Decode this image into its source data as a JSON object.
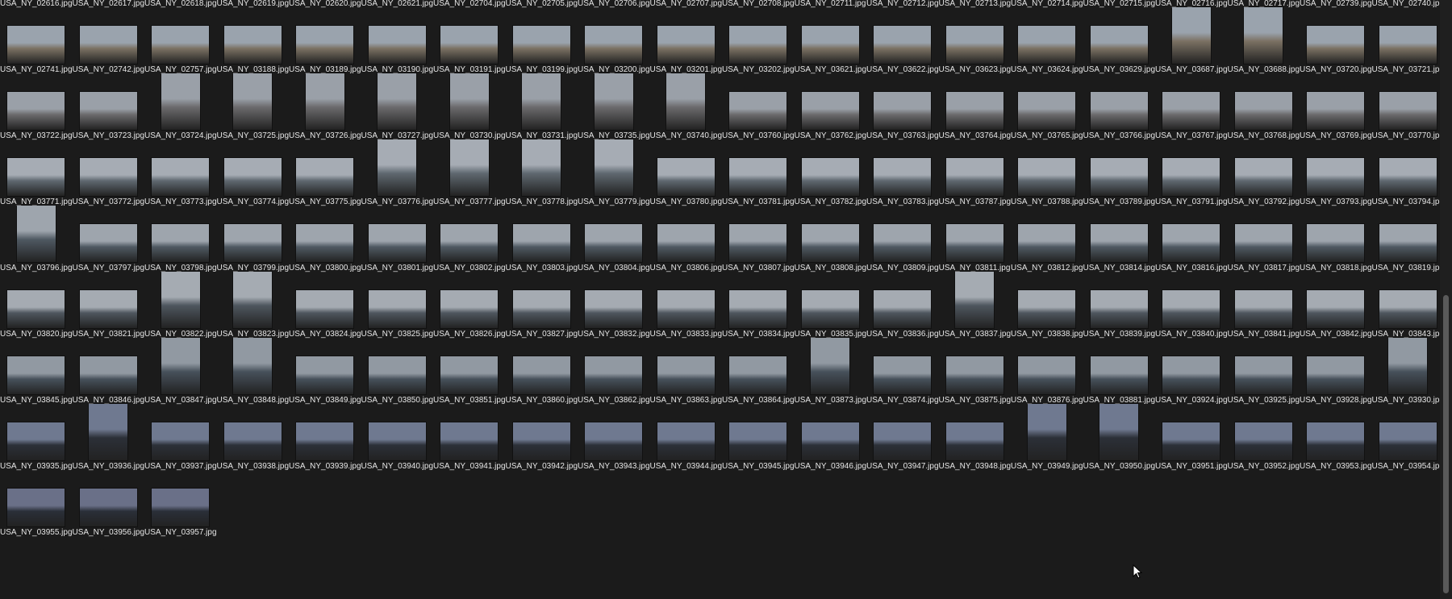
{
  "rows": [
    {
      "portrait_indices": [],
      "files": [
        "USA_NY_02616.jpg",
        "USA_NY_02617.jpg",
        "USA_NY_02618.jpg",
        "USA_NY_02619.jpg",
        "USA_NY_02620.jpg",
        "USA_NY_02621.jpg",
        "USA_NY_02704.jpg",
        "USA_NY_02705.jpg",
        "USA_NY_02706.jpg",
        "USA_NY_02707.jpg",
        "USA_NY_02708.jpg",
        "USA_NY_02711.jpg",
        "USA_NY_02712.jpg",
        "USA_NY_02713.jpg",
        "USA_NY_02714.jpg",
        "USA_NY_02715.jpg",
        "USA_NY_02716.jpg",
        "USA_NY_02717.jpg",
        "USA_NY_02739.jpg",
        "USA_NY_02740.jpg"
      ]
    },
    {
      "portrait_indices": [
        16,
        17
      ],
      "files": [
        "USA_NY_02741.jpg",
        "USA_NY_02742.jpg",
        "USA_NY_02757.jpg",
        "USA_NY_03188.jpg",
        "USA_NY_03189.jpg",
        "USA_NY_03190.jpg",
        "USA_NY_03191.jpg",
        "USA_NY_03199.jpg",
        "USA_NY_03200.jpg",
        "USA_NY_03201.jpg",
        "USA_NY_03202.jpg",
        "USA_NY_03621.jpg",
        "USA_NY_03622.jpg",
        "USA_NY_03623.jpg",
        "USA_NY_03624.jpg",
        "USA_NY_03629.jpg",
        "USA_NY_03687.jpg",
        "USA_NY_03688.jpg",
        "USA_NY_03720.jpg",
        "USA_NY_03721.jpg"
      ]
    },
    {
      "portrait_indices": [
        2,
        3,
        4,
        5,
        6,
        7,
        8,
        9
      ],
      "files": [
        "USA_NY_03722.jpg",
        "USA_NY_03723.jpg",
        "USA_NY_03724.jpg",
        "USA_NY_03725.jpg",
        "USA_NY_03726.jpg",
        "USA_NY_03727.jpg",
        "USA_NY_03730.jpg",
        "USA_NY_03731.jpg",
        "USA_NY_03735.jpg",
        "USA_NY_03740.jpg",
        "USA_NY_03760.jpg",
        "USA_NY_03762.jpg",
        "USA_NY_03763.jpg",
        "USA_NY_03764.jpg",
        "USA_NY_03765.jpg",
        "USA_NY_03766.jpg",
        "USA_NY_03767.jpg",
        "USA_NY_03768.jpg",
        "USA_NY_03769.jpg",
        "USA_NY_03770.jpg"
      ]
    },
    {
      "portrait_indices": [
        5,
        6,
        7,
        8
      ],
      "files": [
        "USA_NY_03771.jpg",
        "USA_NY_03772.jpg",
        "USA_NY_03773.jpg",
        "USA_NY_03774.jpg",
        "USA_NY_03775.jpg",
        "USA_NY_03776.jpg",
        "USA_NY_03777.jpg",
        "USA_NY_03778.jpg",
        "USA_NY_03779.jpg",
        "USA_NY_03780.jpg",
        "USA_NY_03781.jpg",
        "USA_NY_03782.jpg",
        "USA_NY_03783.jpg",
        "USA_NY_03787.jpg",
        "USA_NY_03788.jpg",
        "USA_NY_03789.jpg",
        "USA_NY_03791.jpg",
        "USA_NY_03792.jpg",
        "USA_NY_03793.jpg",
        "USA_NY_03794.jpg"
      ]
    },
    {
      "portrait_indices": [
        0
      ],
      "files": [
        "USA_NY_03796.jpg",
        "USA_NY_03797.jpg",
        "USA_NY_03798.jpg",
        "USA_NY_03799.jpg",
        "USA_NY_03800.jpg",
        "USA_NY_03801.jpg",
        "USA_NY_03802.jpg",
        "USA_NY_03803.jpg",
        "USA_NY_03804.jpg",
        "USA_NY_03806.jpg",
        "USA_NY_03807.jpg",
        "USA_NY_03808.jpg",
        "USA_NY_03809.jpg",
        "USA_NY_03811.jpg",
        "USA_NY_03812.jpg",
        "USA_NY_03814.jpg",
        "USA_NY_03816.jpg",
        "USA_NY_03817.jpg",
        "USA_NY_03818.jpg",
        "USA_NY_03819.jpg"
      ]
    },
    {
      "portrait_indices": [
        2,
        3,
        13
      ],
      "files": [
        "USA_NY_03820.jpg",
        "USA_NY_03821.jpg",
        "USA_NY_03822.jpg",
        "USA_NY_03823.jpg",
        "USA_NY_03824.jpg",
        "USA_NY_03825.jpg",
        "USA_NY_03826.jpg",
        "USA_NY_03827.jpg",
        "USA_NY_03832.jpg",
        "USA_NY_03833.jpg",
        "USA_NY_03834.jpg",
        "USA_NY_03835.jpg",
        "USA_NY_03836.jpg",
        "USA_NY_03837.jpg",
        "USA_NY_03838.jpg",
        "USA_NY_03839.jpg",
        "USA_NY_03840.jpg",
        "USA_NY_03841.jpg",
        "USA_NY_03842.jpg",
        "USA_NY_03843.jpg"
      ]
    },
    {
      "portrait_indices": [
        2,
        3,
        11,
        19
      ],
      "files": [
        "USA_NY_03845.jpg",
        "USA_NY_03846.jpg",
        "USA_NY_03847.jpg",
        "USA_NY_03848.jpg",
        "USA_NY_03849.jpg",
        "USA_NY_03850.jpg",
        "USA_NY_03851.jpg",
        "USA_NY_03860.jpg",
        "USA_NY_03862.jpg",
        "USA_NY_03863.jpg",
        "USA_NY_03864.jpg",
        "USA_NY_03873.jpg",
        "USA_NY_03874.jpg",
        "USA_NY_03875.jpg",
        "USA_NY_03876.jpg",
        "USA_NY_03881.jpg",
        "USA_NY_03924.jpg",
        "USA_NY_03925.jpg",
        "USA_NY_03928.jpg",
        "USA_NY_03930.jpg"
      ]
    },
    {
      "portrait_indices": [
        1,
        14,
        15
      ],
      "files": [
        "USA_NY_03935.jpg",
        "USA_NY_03936.jpg",
        "USA_NY_03937.jpg",
        "USA_NY_03938.jpg",
        "USA_NY_03939.jpg",
        "USA_NY_03940.jpg",
        "USA_NY_03941.jpg",
        "USA_NY_03942.jpg",
        "USA_NY_03943.jpg",
        "USA_NY_03944.jpg",
        "USA_NY_03945.jpg",
        "USA_NY_03946.jpg",
        "USA_NY_03947.jpg",
        "USA_NY_03948.jpg",
        "USA_NY_03949.jpg",
        "USA_NY_03950.jpg",
        "USA_NY_03951.jpg",
        "USA_NY_03952.jpg",
        "USA_NY_03953.jpg",
        "USA_NY_03954.jpg"
      ]
    },
    {
      "portrait_indices": [],
      "files": [
        "USA_NY_03955.jpg",
        "USA_NY_03956.jpg",
        "USA_NY_03957.jpg"
      ]
    }
  ],
  "tones": [
    [
      "#6f7276",
      "#8a8f96"
    ],
    [
      "#7b7163",
      "#9aa3ad"
    ],
    [
      "#6b6a6c",
      "#9aa0a8"
    ],
    [
      "#5f6870",
      "#a6acb4"
    ],
    [
      "#4f5962",
      "#9ea5ad"
    ],
    [
      "#4e565e",
      "#a5abb2"
    ],
    [
      "#47515b",
      "#9199a2"
    ],
    [
      "#2c3038",
      "#6f7990"
    ],
    [
      "#2a2f38",
      "#6a7088"
    ]
  ],
  "colors": {
    "background": "#1b1b1b",
    "label_text": "#e6e6e6",
    "scroll_thumb": "#5a5a5a"
  }
}
